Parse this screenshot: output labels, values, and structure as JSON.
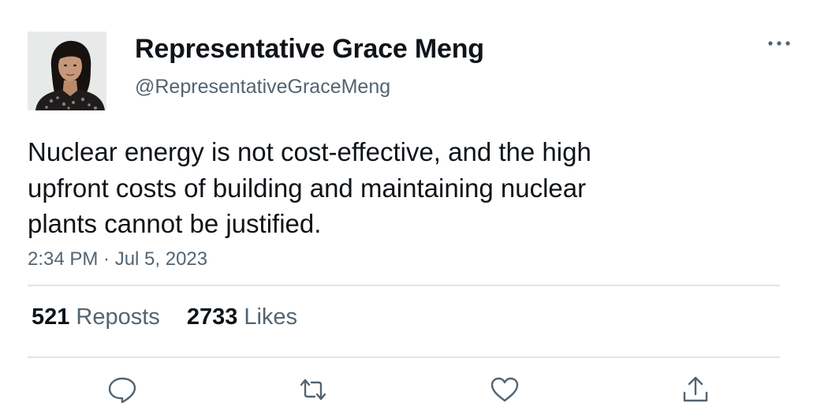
{
  "author": {
    "display_name": "Representative Grace Meng",
    "handle": "@RepresentativeGraceMeng",
    "avatar_icon": "profile-photo"
  },
  "tweet": {
    "text": "Nuclear energy is not cost-effective, and the high upfront costs of building and maintaining nuclear plants cannot be justified.",
    "timestamp": "2:34 PM · Jul 5, 2023"
  },
  "stats": {
    "reposts_count": "521",
    "reposts_label": "Reposts",
    "likes_count": "2733",
    "likes_label": "Likes"
  },
  "actions": [
    {
      "icon": "reply-icon"
    },
    {
      "icon": "repost-icon"
    },
    {
      "icon": "like-icon"
    },
    {
      "icon": "share-icon"
    }
  ],
  "colors": {
    "text_primary": "#0f1419",
    "text_secondary": "#536471",
    "divider": "#e1e4e6"
  }
}
